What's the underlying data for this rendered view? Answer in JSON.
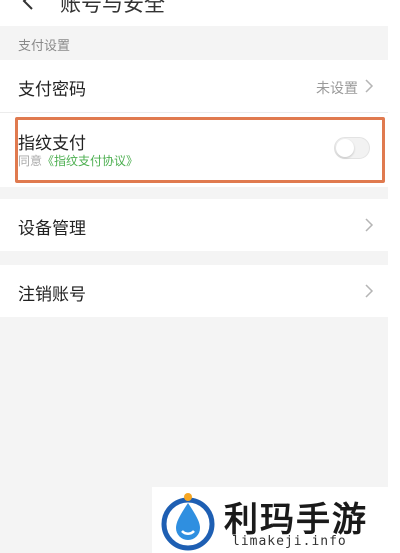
{
  "header": {
    "title": "账号与安全",
    "back_icon": "chevron-left-icon"
  },
  "section": {
    "title": "支付设置"
  },
  "rows": {
    "pay_password": {
      "label": "支付密码",
      "value": "未设置",
      "icon": "chevron-right-icon"
    },
    "fingerprint": {
      "label": "指纹支付",
      "sublabel_prefix": "同意",
      "sublabel_link": "《指纹支付协议》",
      "toggle_on": false,
      "highlight_color": "#e07a4f"
    },
    "device_management": {
      "label": "设备管理",
      "icon": "chevron-right-icon"
    },
    "cancel_account": {
      "label": "注销账号",
      "icon": "chevron-right-icon"
    }
  },
  "watermark": {
    "name": "利玛手游",
    "url": "limakeji.info"
  },
  "colors": {
    "background": "#f4f4f4",
    "link": "#4caf50",
    "highlight": "#e07a4f"
  }
}
